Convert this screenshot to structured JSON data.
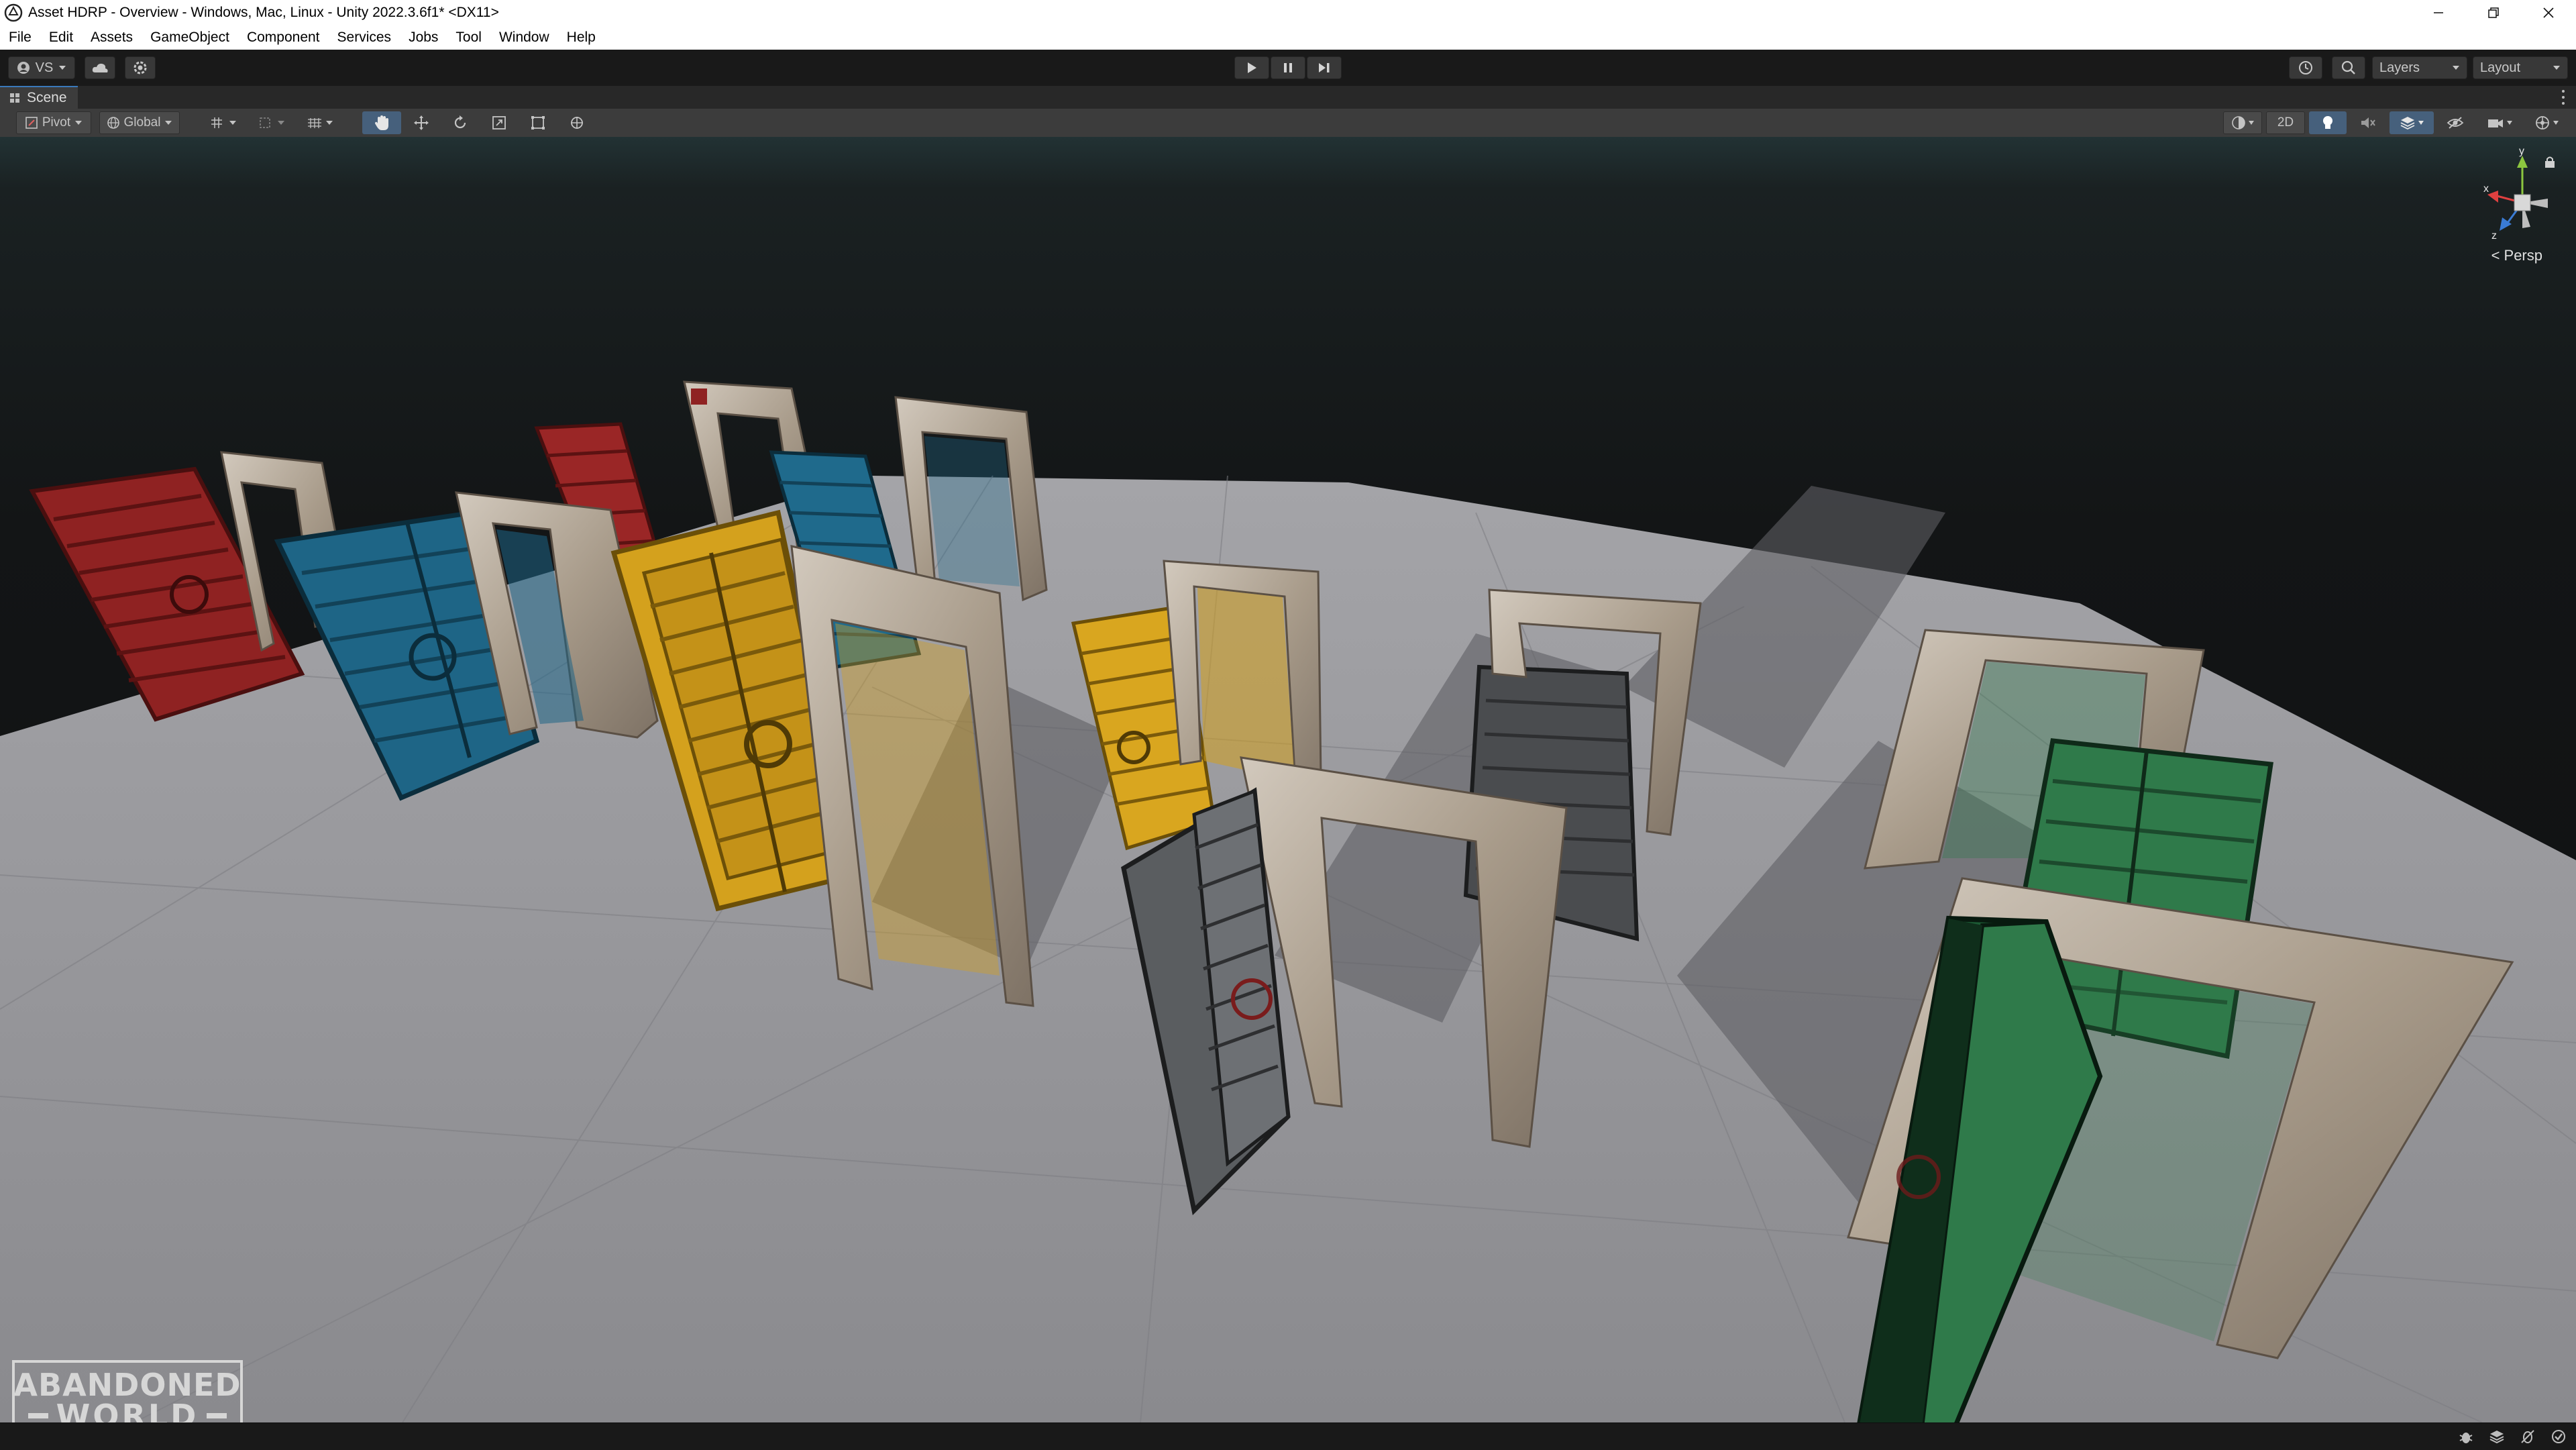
{
  "window": {
    "title": "Asset HDRP - Overview - Windows, Mac, Linux - Unity 2022.3.6f1* <DX11>",
    "controls": [
      "minimize-icon",
      "restore-icon",
      "close-icon"
    ]
  },
  "menu": {
    "items": [
      "File",
      "Edit",
      "Assets",
      "GameObject",
      "Component",
      "Services",
      "Jobs",
      "Tool",
      "Window",
      "Help"
    ]
  },
  "toolbar": {
    "account_label": "VS",
    "icons": [
      "cloud-icon",
      "settings-icon",
      "play-icon",
      "pause-icon",
      "step-icon",
      "history-icon",
      "search-icon"
    ],
    "layers_label": "Layers",
    "layout_label": "Layout"
  },
  "scene_tab": {
    "label": "Scene"
  },
  "scene_toolbar": {
    "pivot_label": "Pivot",
    "space_label": "Global",
    "mode_2d_label": "2D",
    "tools": [
      "hand-tool-icon",
      "move-tool-icon",
      "rotate-tool-icon",
      "scale-tool-icon",
      "rect-tool-icon",
      "transform-tool-icon"
    ]
  },
  "scene_view": {
    "gizmo_axes": [
      "y",
      "x",
      "z"
    ],
    "projection_label": "< Persp",
    "doors": [
      {
        "color_name": "red",
        "color": "#9a2626"
      },
      {
        "color_name": "blue",
        "color": "#1f6a8c"
      },
      {
        "color_name": "yellow",
        "color": "#d4a11d"
      },
      {
        "color_name": "gray",
        "color": "#5e6063"
      },
      {
        "color_name": "green",
        "color": "#2f7a4a"
      }
    ]
  },
  "logo": {
    "line1": "ABANDONED",
    "line2": "WORLD"
  },
  "colors": {
    "editor_bg": "#191919",
    "panel_bg": "#3c3c3c",
    "accent_blue": "#3a79bb",
    "floor": "#8a8a8e",
    "sky": "#1b1e1f"
  }
}
